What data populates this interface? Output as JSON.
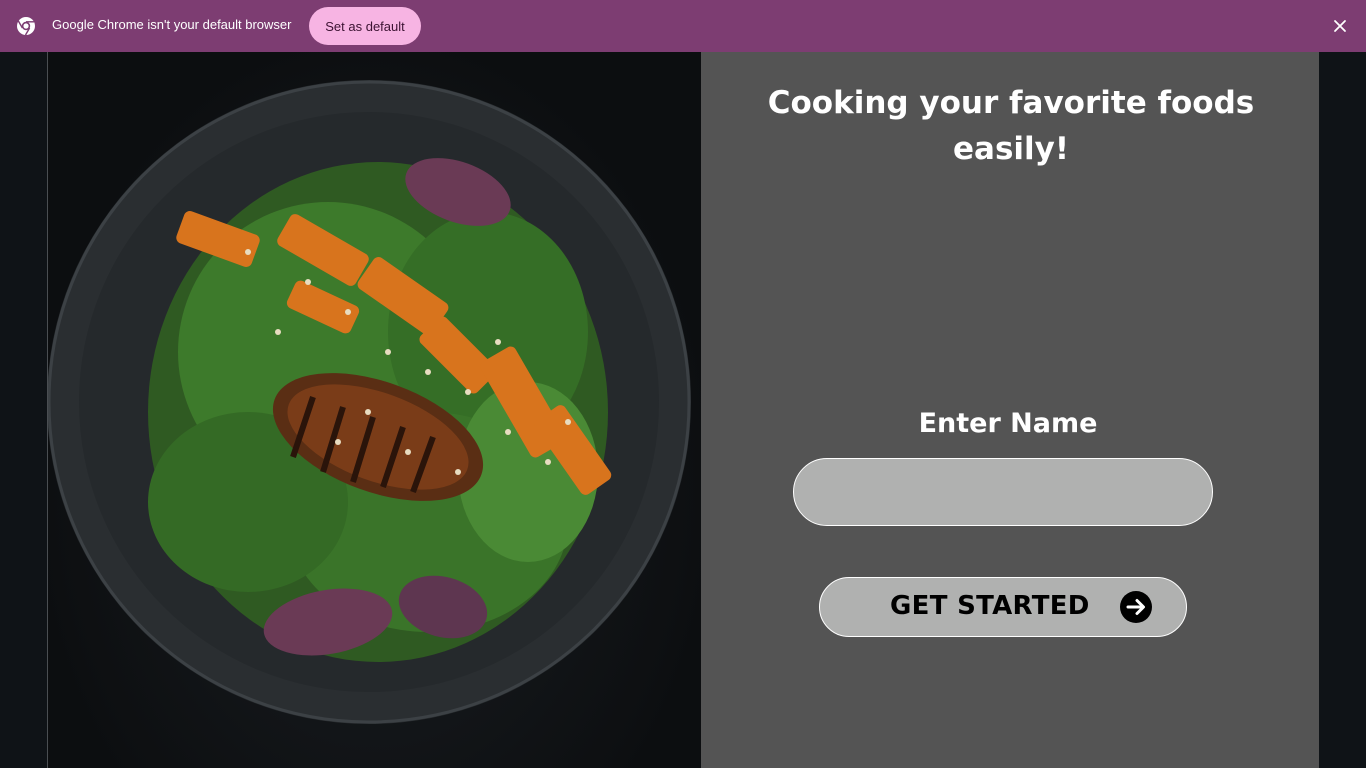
{
  "infobar": {
    "message": "Google Chrome isn't your default browser",
    "set_default_label": "Set as default",
    "chrome_icon": "chrome-icon",
    "close_icon": "close-icon",
    "background_color": "#7d3d72",
    "button_color": "#f7b4e3"
  },
  "hero": {
    "headline": "Cooking your favorite foods easily!",
    "image_icon": "salad-plate-photo"
  },
  "form": {
    "name_label": "Enter Name",
    "name_value": "",
    "button_label": "GET STARTED",
    "button_icon": "arrow-right-circle-icon",
    "panel_color": "#545454",
    "field_color": "#b0b1b0"
  }
}
